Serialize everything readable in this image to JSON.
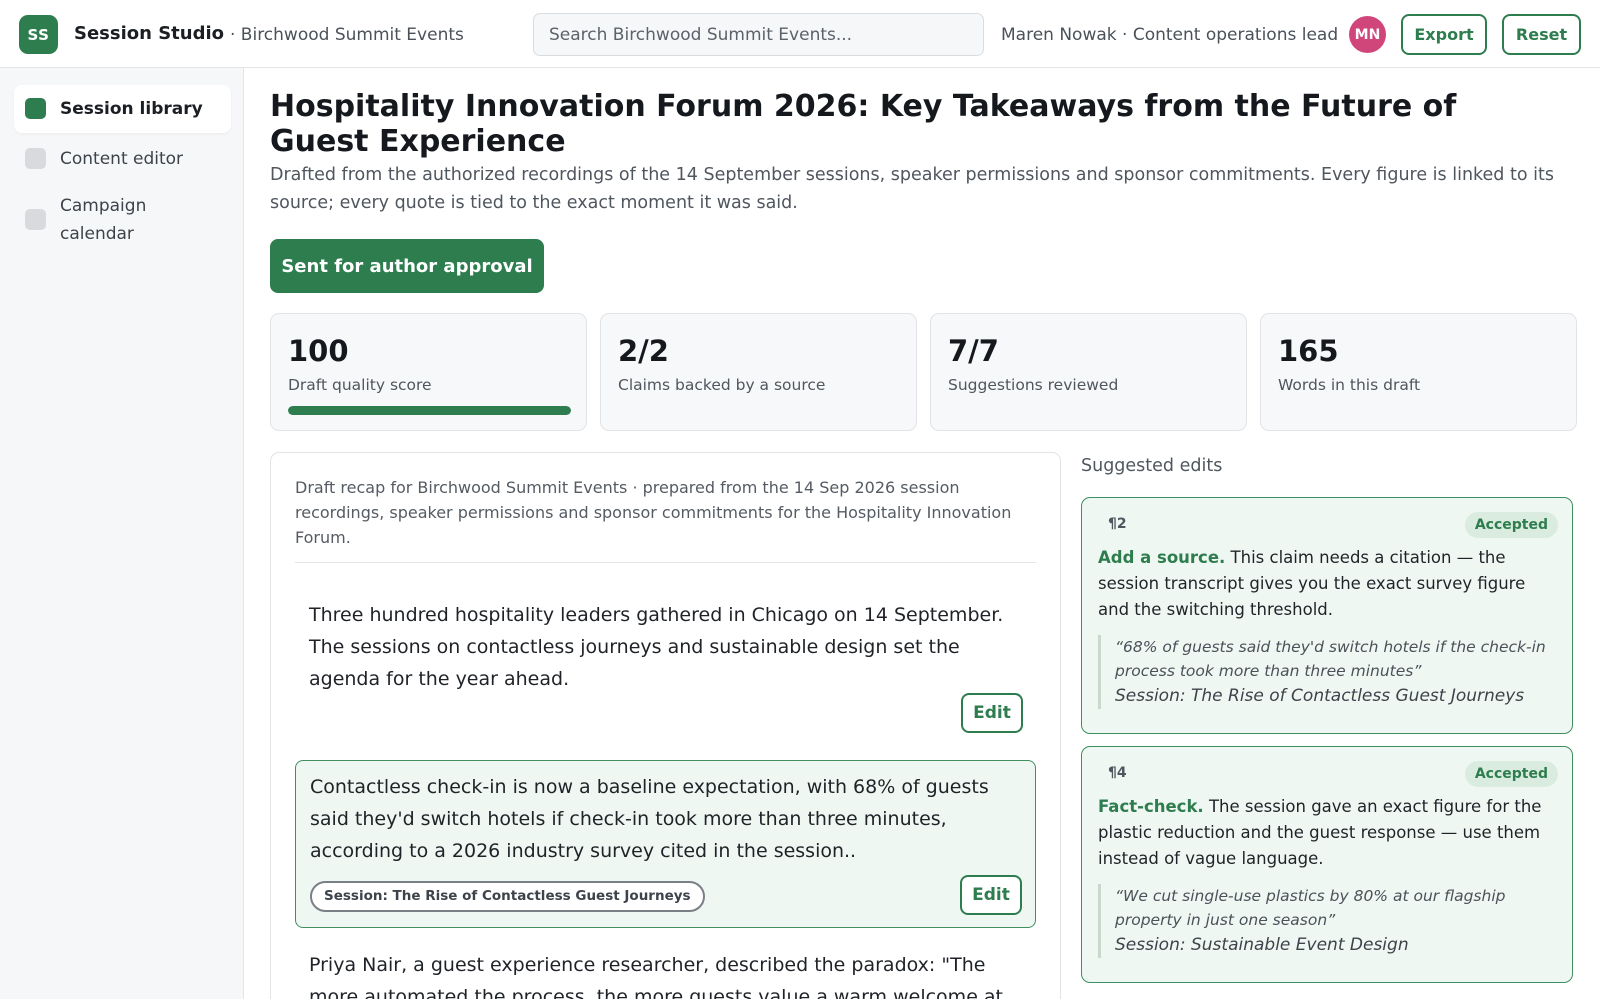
{
  "header": {
    "logo_initials": "SS",
    "app_title": "Session Studio",
    "workspace": "· Birchwood Summit Events",
    "search_placeholder": "Search Birchwood Summit Events...",
    "user_meta": "Maren Nowak · Content operations lead",
    "avatar_initials": "MN",
    "export_label": "Export",
    "reset_label": "Reset"
  },
  "sidebar": {
    "items": [
      {
        "label": "Session library",
        "active": true
      },
      {
        "label": "Content editor",
        "active": false
      },
      {
        "label": "Campaign calendar",
        "active": false
      }
    ]
  },
  "main": {
    "title": "Hospitality Innovation Forum 2026: Key Takeaways from the Future of Guest Experience",
    "subtitle": "Drafted from the authorized recordings of the 14 September sessions, speaker permissions and sponsor commitments. Every figure is linked to its source; every quote is tied to the exact moment it was said.",
    "status_button": "Sent for author approval",
    "stats": [
      {
        "value": "100",
        "label": "Draft quality score",
        "progress": 1.0
      },
      {
        "value": "2/2",
        "label": "Claims backed by a source"
      },
      {
        "value": "7/7",
        "label": "Suggestions reviewed"
      },
      {
        "value": "165",
        "label": "Words in this draft"
      }
    ]
  },
  "draft": {
    "meta": "Draft recap for Birchwood Summit Events · prepared from the 14 Sep 2026 session recordings, speaker permissions and sponsor commitments for the Hospitality Innovation Forum.",
    "edit_label": "Edit",
    "paragraphs": [
      {
        "text": "Three hundred hospitality leaders gathered in Chicago on 14 September. The sessions on contactless journeys and sustainable design set the agenda for the year ahead."
      },
      {
        "text": "Contactless check-in is now a baseline expectation, with 68% of guests said they'd switch hotels if check-in took more than three minutes, according to a 2026 industry survey cited in the session..",
        "source": "Session: The Rise of Contactless Guest Journeys"
      },
      {
        "text": "Priya Nair, a guest experience researcher, described the paradox: \"The more automated the process, the more guests value a warm welcome at"
      }
    ]
  },
  "suggestions": {
    "heading": "Suggested edits",
    "items": [
      {
        "para": "¶2",
        "status": "Accepted",
        "kind": "Add a source.",
        "text": "This claim needs a citation — the session transcript gives you the exact survey figure and the switching threshold.",
        "quote": "“68% of guests said they'd switch hotels if the check-in process took more than three minutes”",
        "source": "Session: The Rise of Contactless Guest Journeys"
      },
      {
        "para": "¶4",
        "status": "Accepted",
        "kind": "Fact-check.",
        "text": "The session gave an exact figure for the plastic reduction and the guest response — use them instead of vague language.",
        "quote": "“We cut single-use plastics by 80% at our flagship property in just one season”",
        "source": "Session: Sustainable Event Design"
      }
    ]
  }
}
